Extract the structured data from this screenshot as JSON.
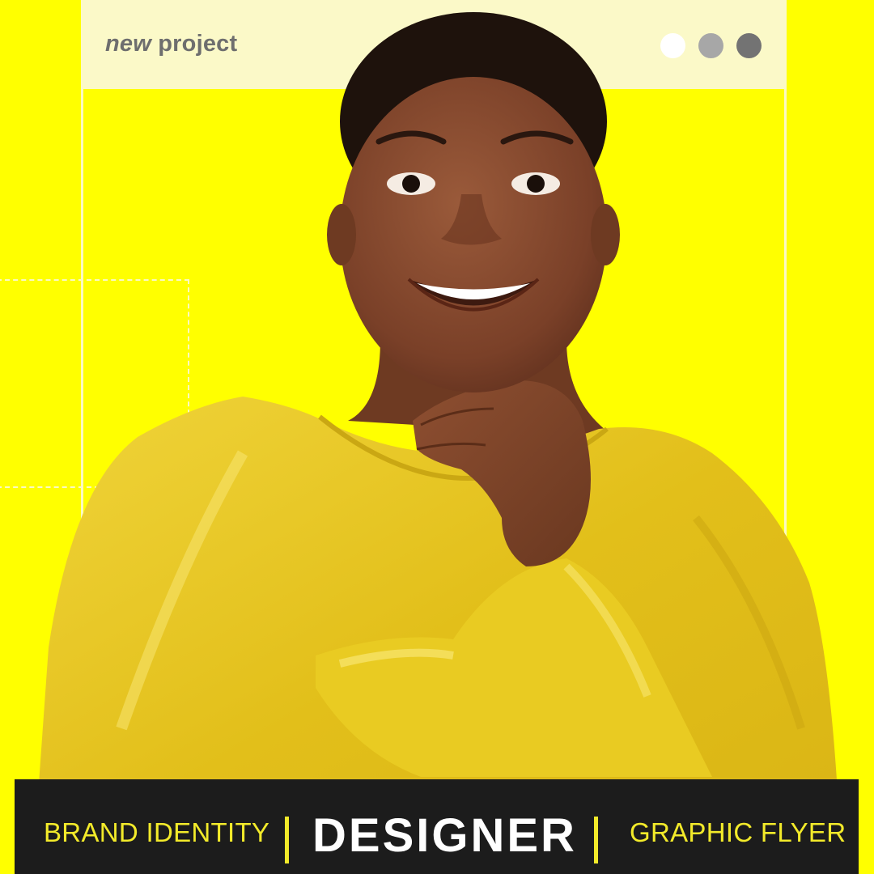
{
  "window": {
    "title_italic": "new",
    "title_rest": "project",
    "dots": [
      {
        "color": "#ffffff"
      },
      {
        "color": "#a7a7a7"
      },
      {
        "color": "#737373"
      }
    ]
  },
  "colors": {
    "background": "#ffff00",
    "titlebar": "#fbf9c8",
    "banner": "#1c1c1c",
    "accent_text": "#f2ea2a",
    "dress": "#e6c61e"
  },
  "banner": {
    "left_label": "BRAND IDENTITY",
    "center_label": "DESIGNER",
    "right_label": "GRAPHIC FLYER"
  },
  "image": {
    "subject": "smiling-woman-portrait"
  }
}
